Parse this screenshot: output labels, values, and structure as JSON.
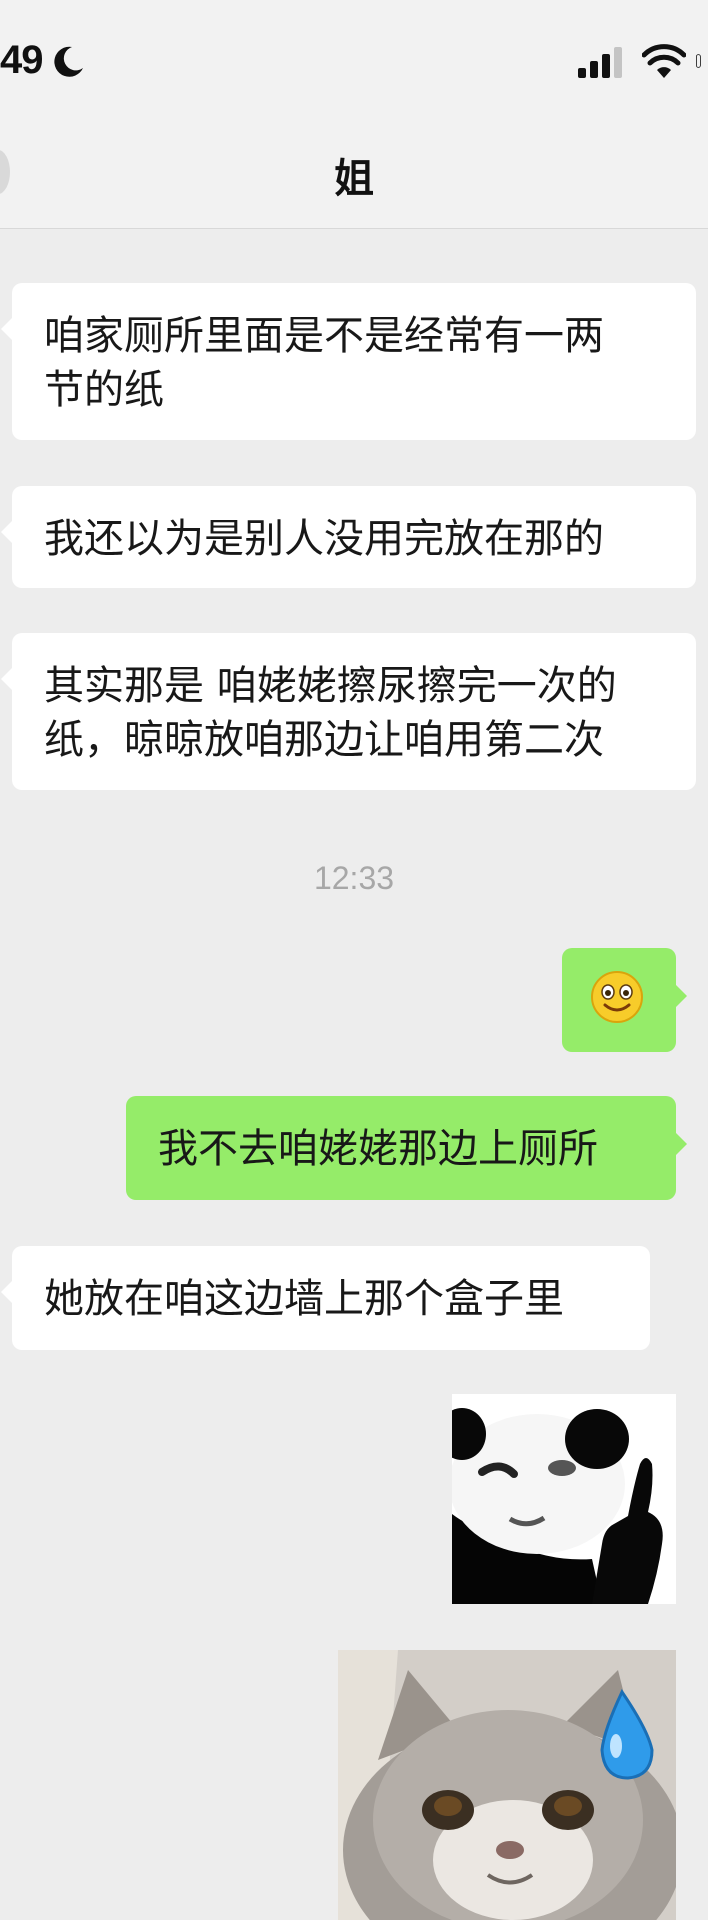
{
  "status_bar": {
    "time": "49",
    "moon_icon": "moon-icon",
    "signal_icon": "cellular-signal-icon",
    "wifi_icon": "wifi-icon",
    "battery_icon": "battery-icon"
  },
  "nav": {
    "title": "姐",
    "back_icon": "back-icon"
  },
  "messages": [
    {
      "side": "in",
      "text": "咱家厕所里面是不是经常有一两\n节的纸"
    },
    {
      "side": "in",
      "text": "我还以为是别人没用完放在那的"
    },
    {
      "side": "in",
      "text": "其实那是 咱姥姥擦尿擦完一次的\n纸，晾晾放咱那边让咱用第二次"
    },
    {
      "side": "out",
      "type": "emoji",
      "emoji": "smile-emoji-icon"
    },
    {
      "side": "out",
      "text": "我不去咱姥姥那边上厕所"
    },
    {
      "side": "in",
      "text": "她放在咱这边墙上那个盒子里"
    },
    {
      "side": "out",
      "type": "sticker",
      "sticker": "panda-face-pointing-sticker"
    },
    {
      "side": "out",
      "type": "sticker",
      "sticker": "cat-sweat-drop-sticker"
    }
  ],
  "timestamp": "12:33",
  "colors": {
    "background": "#ededed",
    "incoming_bubble": "#ffffff",
    "outgoing_bubble": "#95ec69",
    "timestamp": "#a7a7a7"
  }
}
